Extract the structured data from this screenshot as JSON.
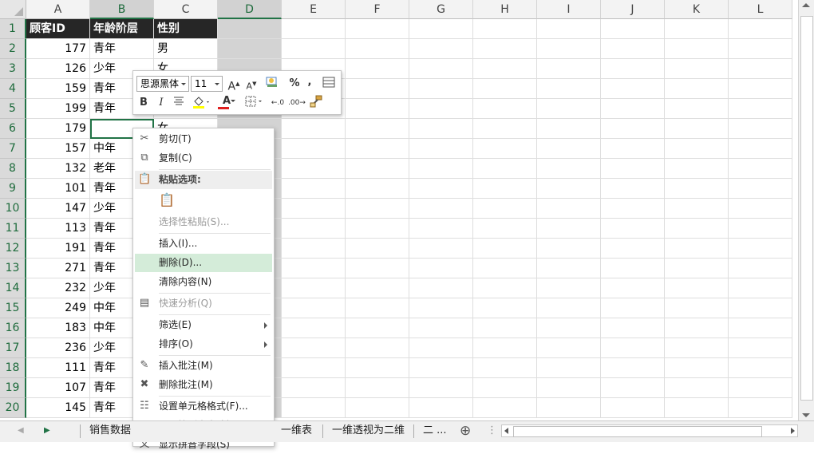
{
  "columns": [
    {
      "label": "A",
      "width": 80,
      "sel": false
    },
    {
      "label": "B",
      "width": 80,
      "sel": true
    },
    {
      "label": "C",
      "width": 80,
      "sel": false
    },
    {
      "label": "D",
      "width": 80,
      "sel": true
    },
    {
      "label": "E",
      "width": 80,
      "sel": false
    },
    {
      "label": "F",
      "width": 80,
      "sel": false
    },
    {
      "label": "G",
      "width": 80,
      "sel": false
    },
    {
      "label": "H",
      "width": 80,
      "sel": false
    },
    {
      "label": "I",
      "width": 80,
      "sel": false
    },
    {
      "label": "J",
      "width": 80,
      "sel": false
    },
    {
      "label": "K",
      "width": 80,
      "sel": false
    },
    {
      "label": "L",
      "width": 80,
      "sel": false
    }
  ],
  "rows": [
    "1",
    "2",
    "3",
    "4",
    "5",
    "6",
    "7",
    "8",
    "9",
    "10",
    "11",
    "12",
    "13",
    "14",
    "15",
    "16",
    "17",
    "18",
    "19",
    "20"
  ],
  "header": [
    "顾客ID",
    "年龄阶层",
    "性别"
  ],
  "data": [
    [
      "177",
      "青年",
      "男"
    ],
    [
      "126",
      "少年",
      "女"
    ],
    [
      "159",
      "青年",
      ""
    ],
    [
      "199",
      "青年",
      ""
    ],
    [
      "179",
      "",
      "女"
    ],
    [
      "157",
      "中年",
      ""
    ],
    [
      "132",
      "老年",
      ""
    ],
    [
      "101",
      "青年",
      ""
    ],
    [
      "147",
      "少年",
      ""
    ],
    [
      "113",
      "青年",
      ""
    ],
    [
      "191",
      "青年",
      ""
    ],
    [
      "271",
      "青年",
      ""
    ],
    [
      "232",
      "少年",
      ""
    ],
    [
      "249",
      "中年",
      ""
    ],
    [
      "183",
      "中年",
      ""
    ],
    [
      "236",
      "少年",
      ""
    ],
    [
      "111",
      "青年",
      ""
    ],
    [
      "107",
      "青年",
      ""
    ],
    [
      "145",
      "青年",
      ""
    ]
  ],
  "minitoolbar": {
    "font_name": "思源黑体",
    "font_size": "11",
    "grow_font": "A",
    "shrink_font": "A",
    "percent": "%",
    "comma": ",",
    "bold": "B",
    "italic": "I",
    "font_color_letter": "A",
    "dec_increase": ".0",
    "dec_decrease": ".00"
  },
  "context_menu": [
    {
      "label": "剪切(T)",
      "icon": "scissors-icon",
      "glyph": "✂",
      "state": "normal"
    },
    {
      "label": "复制(C)",
      "icon": "copy-icon",
      "glyph": "⧉",
      "state": "normal"
    },
    {
      "label": "粘贴选项:",
      "icon": "paste-icon",
      "glyph": "📋",
      "state": "section"
    },
    {
      "label": "",
      "icon": "paste-option-icon",
      "glyph": "📋",
      "state": "disabled"
    },
    {
      "label": "选择性粘贴(S)...",
      "icon": "",
      "glyph": "",
      "state": "disabled"
    },
    {
      "label": "插入(I)...",
      "icon": "",
      "glyph": "",
      "state": "normal"
    },
    {
      "label": "删除(D)...",
      "icon": "",
      "glyph": "",
      "state": "highlight"
    },
    {
      "label": "清除内容(N)",
      "icon": "",
      "glyph": "",
      "state": "normal"
    },
    {
      "label": "快速分析(Q)",
      "icon": "quick-analysis-icon",
      "glyph": "▤",
      "state": "disabled"
    },
    {
      "label": "筛选(E)",
      "icon": "",
      "glyph": "",
      "state": "submenu"
    },
    {
      "label": "排序(O)",
      "icon": "",
      "glyph": "",
      "state": "submenu"
    },
    {
      "label": "插入批注(M)",
      "icon": "insert-comment-icon",
      "glyph": "✎",
      "state": "normal"
    },
    {
      "label": "删除批注(M)",
      "icon": "delete-comment-icon",
      "glyph": "✖",
      "state": "normal"
    },
    {
      "label": "设置单元格格式(F)...",
      "icon": "format-cells-icon",
      "glyph": "☷",
      "state": "normal"
    },
    {
      "label": "从下拉列表中选择(K)...",
      "icon": "",
      "glyph": "",
      "state": "normal"
    },
    {
      "label": "显示拼音字段(S)",
      "icon": "phonetic-icon",
      "glyph": "文",
      "state": "normal"
    }
  ],
  "tabs": {
    "tab1": "销售数据",
    "tab2": "一维表",
    "tab3": "一维透视为二维",
    "tab4": "二 ...",
    "add": "⊕"
  }
}
